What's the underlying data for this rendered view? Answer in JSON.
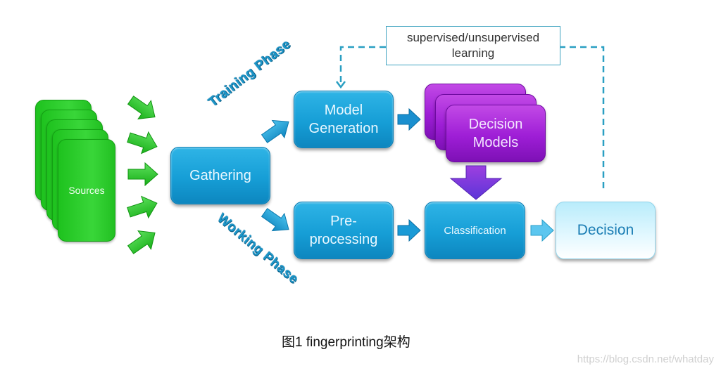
{
  "diagram": {
    "sources_label": "Sources",
    "gathering_label": "Gathering",
    "training_phase_label": "Training Phase",
    "working_phase_label": "Working Phase",
    "model_generation_label_line1": "Model",
    "model_generation_label_line2": "Generation",
    "decision_models_label_line1": "Decision",
    "decision_models_label_line2": "Models",
    "preprocessing_label_line1": "Pre-",
    "preprocessing_label_line2": "processing",
    "classification_label": "Classification",
    "decision_label": "Decision",
    "learning_label_line1": "supervised/unsupervised",
    "learning_label_line2": "learning"
  },
  "colors": {
    "source_green": "#2ccc2c",
    "process_blue": "#169ed6",
    "model_purple": "#9e1ed6",
    "decision_light": "#d8f5ff",
    "feedback_dash": "#2a9fc2"
  },
  "caption": "图1 fingerprinting架构",
  "watermark": "https://blog.csdn.net/whatday"
}
